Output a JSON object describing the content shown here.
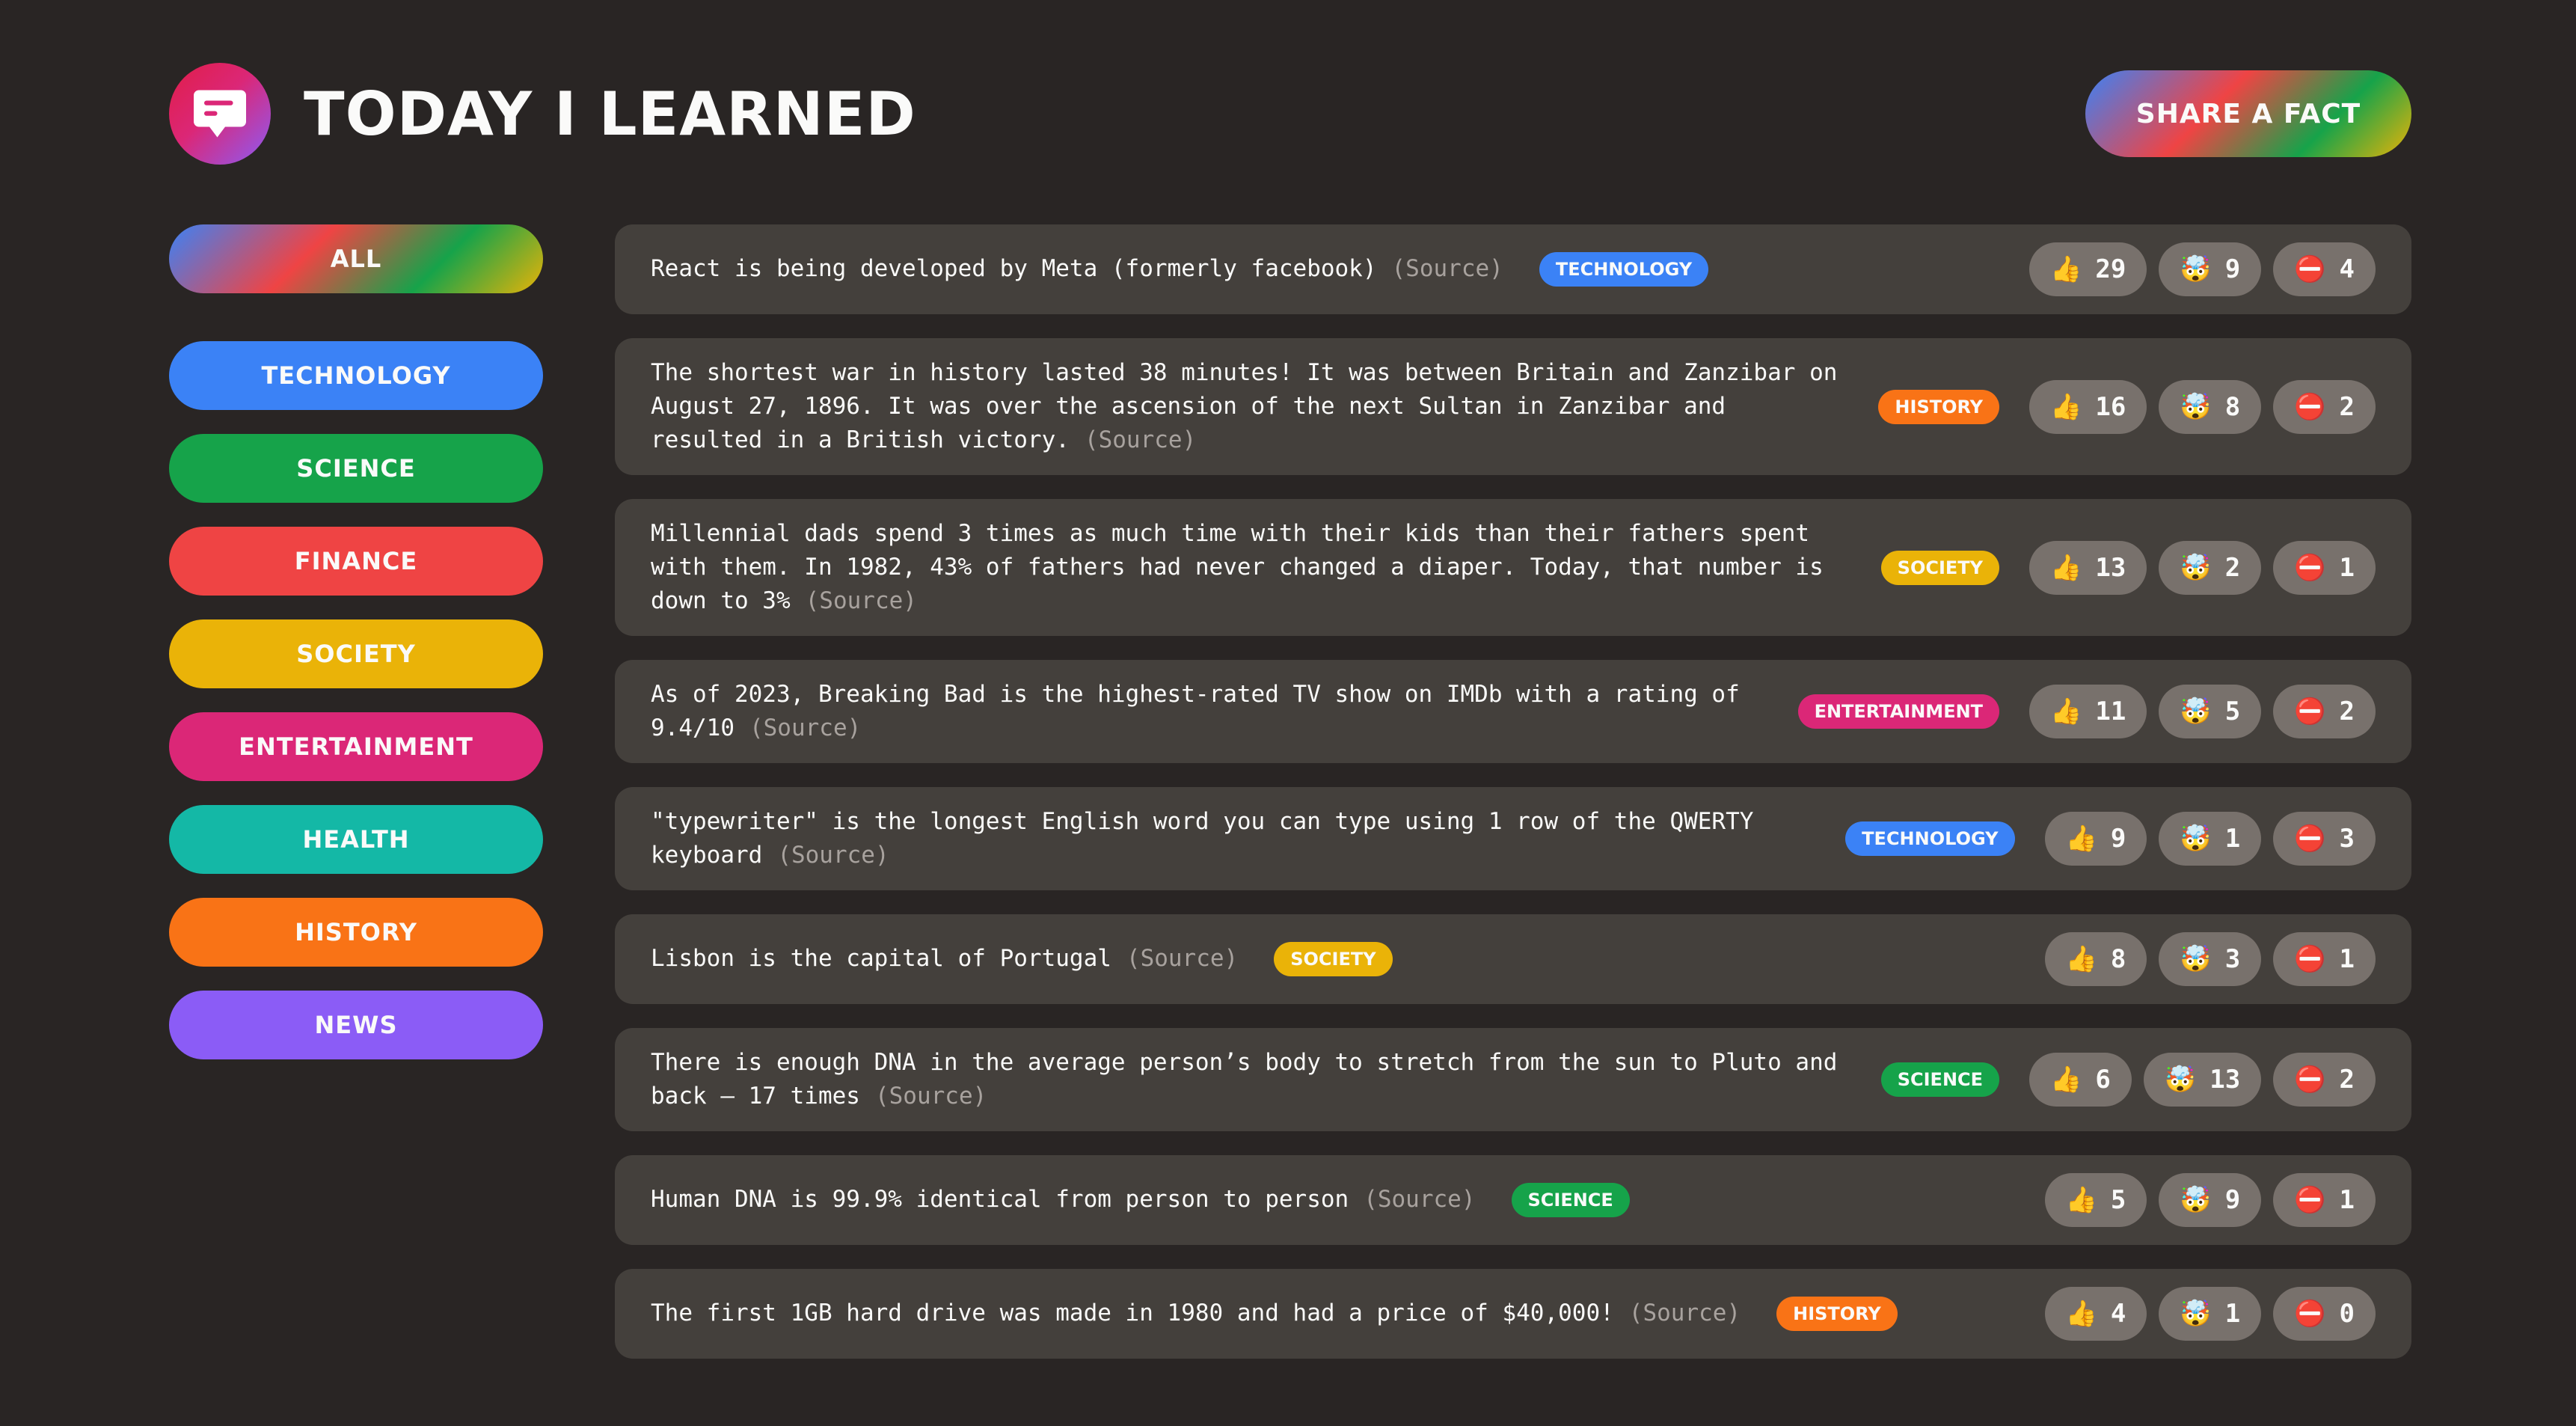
{
  "header": {
    "title": "Today I Learned",
    "share_label": "Share a fact"
  },
  "sidebar": {
    "all_label": "All",
    "categories": [
      {
        "label": "Technology",
        "color": "#3b82f6"
      },
      {
        "label": "Science",
        "color": "#16a34a"
      },
      {
        "label": "Finance",
        "color": "#ef4444"
      },
      {
        "label": "Society",
        "color": "#eab308"
      },
      {
        "label": "Entertainment",
        "color": "#db2777"
      },
      {
        "label": "Health",
        "color": "#14b8a6"
      },
      {
        "label": "History",
        "color": "#f97316"
      },
      {
        "label": "News",
        "color": "#8b5cf6"
      }
    ]
  },
  "facts": [
    {
      "text": "React is being developed by Meta (formerly facebook)",
      "source": "(Source)",
      "tag": "Technology",
      "tag_color": "#3b82f6",
      "likes": "29",
      "mindblowing": "9",
      "false": "4"
    },
    {
      "text": "The shortest war in history lasted 38 minutes! It was between Britain and Zanzibar on August 27, 1896. It was over the ascension of the next Sultan in Zanzibar and resulted in a British victory.",
      "source": "(Source)",
      "tag": "History",
      "tag_color": "#f97316",
      "likes": "16",
      "mindblowing": "8",
      "false": "2"
    },
    {
      "text": "Millennial dads spend 3 times as much time with their kids than their fathers spent with them. In 1982, 43% of fathers had never changed a diaper. Today, that number is down to 3%",
      "source": "(Source)",
      "tag": "Society",
      "tag_color": "#eab308",
      "likes": "13",
      "mindblowing": "2",
      "false": "1"
    },
    {
      "text": "As of 2023, Breaking Bad is the highest-rated TV show on IMDb with a rating of 9.4/10",
      "source": "(Source)",
      "tag": "Entertainment",
      "tag_color": "#db2777",
      "likes": "11",
      "mindblowing": "5",
      "false": "2"
    },
    {
      "text": "\"typewriter\" is the longest English word you can type using 1 row of the QWERTY keyboard",
      "source": "(Source)",
      "tag": "Technology",
      "tag_color": "#3b82f6",
      "likes": "9",
      "mindblowing": "1",
      "false": "3"
    },
    {
      "text": "Lisbon is the capital of Portugal",
      "source": "(Source)",
      "tag": "Society",
      "tag_color": "#eab308",
      "likes": "8",
      "mindblowing": "3",
      "false": "1"
    },
    {
      "text": "There is enough DNA in the average person’s body to stretch from the sun to Pluto and back — 17 times",
      "source": "(Source)",
      "tag": "Science",
      "tag_color": "#16a34a",
      "likes": "6",
      "mindblowing": "13",
      "false": "2"
    },
    {
      "text": "Human DNA is 99.9% identical from person to person",
      "source": "(Source)",
      "tag": "Science",
      "tag_color": "#16a34a",
      "likes": "5",
      "mindblowing": "9",
      "false": "1"
    },
    {
      "text": "The first 1GB hard drive was made in 1980 and had a price of $40,000!",
      "source": "(Source)",
      "tag": "History",
      "tag_color": "#f97316",
      "likes": "4",
      "mindblowing": "1",
      "false": "0"
    }
  ],
  "icons": {
    "logo": "chat-bubble-icon",
    "like": "thumbs-up-icon",
    "mindblowing": "mind-blown-icon",
    "false": "no-entry-icon"
  }
}
